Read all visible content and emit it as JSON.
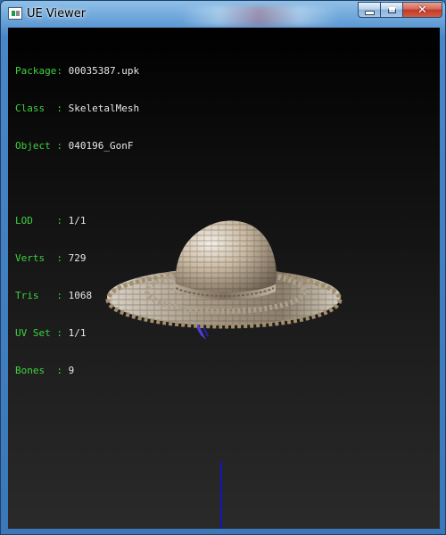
{
  "window": {
    "title": "UE Viewer",
    "buttons": {
      "minimize": "minimize",
      "maximize": "maximize",
      "close": "✕"
    }
  },
  "info": {
    "rows_group1": [
      {
        "label": "Package",
        "value": "00035387.upk"
      },
      {
        "label": "Class  ",
        "value": "SkeletalMesh"
      },
      {
        "label": "Object ",
        "value": "040196_GonF"
      }
    ],
    "rows_group2": [
      {
        "label": "LOD    ",
        "value": "1/1"
      },
      {
        "label": "Verts  ",
        "value": "729"
      },
      {
        "label": "Tris   ",
        "value": "1068"
      },
      {
        "label": "UV Set ",
        "value": "1/1"
      },
      {
        "label": "Bones  ",
        "value": "9"
      }
    ]
  },
  "colors": {
    "label": "#3fd23f",
    "value": "#e8e8e8",
    "axis": "#1515b8",
    "bone": "#4a3fcf"
  },
  "icons": {
    "app": "app-icon",
    "minimize": "minimize-icon",
    "maximize": "maximize-icon",
    "close": "close-icon"
  }
}
